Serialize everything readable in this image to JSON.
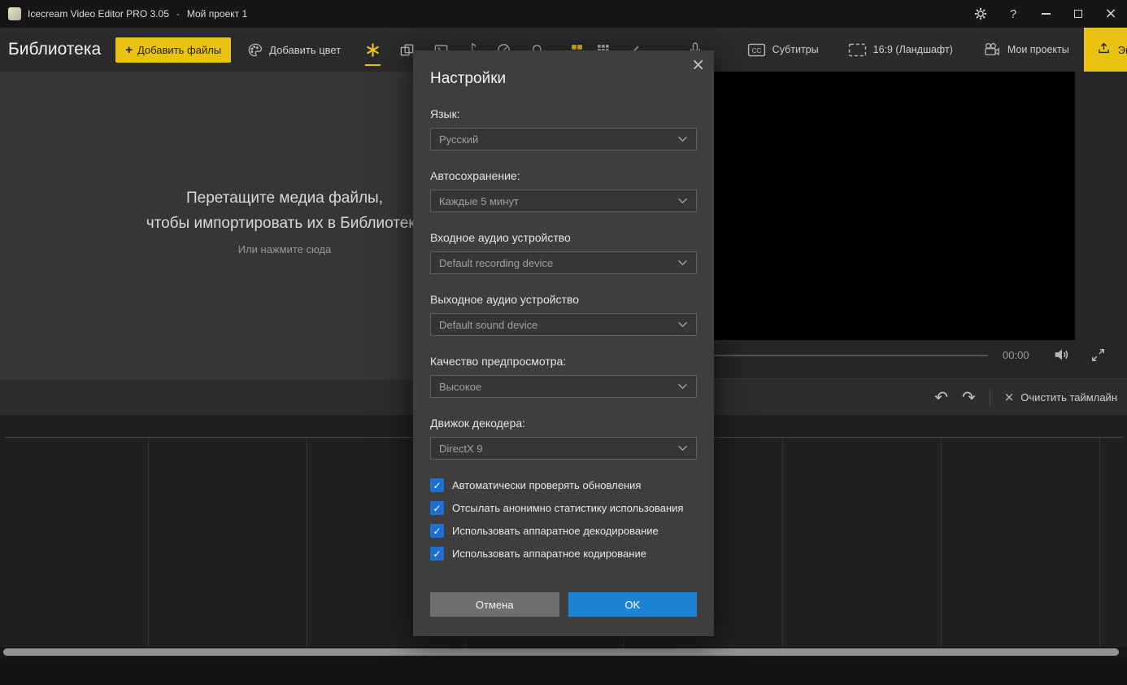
{
  "titlebar": {
    "app_title": "Icecream Video Editor PRO 3.05",
    "separator": "-",
    "project_name": "Мой проект 1"
  },
  "toolbar": {
    "library_title": "Библиотека",
    "add_files": "Добавить файлы",
    "add_color": "Добавить цвет",
    "subtitles": "Субтитры",
    "aspect_ratio": "16:9 (Ландшафт)",
    "my_projects": "Мои проекты",
    "export": "Экспортировать видео"
  },
  "library": {
    "drop_line1": "Перетащите медиа файлы,",
    "drop_line2": "чтобы импортировать их в Библиотеку",
    "click_hint": "Или нажмите сюда"
  },
  "preview": {
    "time": "00:00"
  },
  "timeline": {
    "clear": "Очистить таймлайн"
  },
  "settings_dialog": {
    "title": "Настройки",
    "fields": [
      {
        "label": "Язык:",
        "value": "Русский"
      },
      {
        "label": "Автосохранение:",
        "value": "Каждые 5 минут"
      },
      {
        "label": "Входное аудио устройство",
        "value": "Default recording device"
      },
      {
        "label": "Выходное аудио устройство",
        "value": "Default sound device"
      },
      {
        "label": "Качество предпросмотра:",
        "value": "Высокое"
      },
      {
        "label": "Движок декодера:",
        "value": "DirectX 9"
      }
    ],
    "checkboxes": [
      {
        "label": "Автоматически проверять обновления",
        "checked": true
      },
      {
        "label": "Отсылать анонимно статистику использования",
        "checked": true
      },
      {
        "label": "Использовать аппаратное декодирование",
        "checked": true
      },
      {
        "label": "Использовать аппаратное кодирование",
        "checked": true
      }
    ],
    "cancel": "Отмена",
    "ok": "OK"
  },
  "icons": {
    "plus": "+",
    "music": "♪",
    "chevron_left": "‹",
    "help": "?",
    "undo": "↶",
    "redo": "↷",
    "clear_x": "×",
    "close_x": "×",
    "cc": "CC",
    "check": "✓"
  },
  "colors": {
    "accent_yellow": "#e9c213",
    "ok_blue": "#1d83d4",
    "checkbox_blue": "#1d6fd1"
  }
}
